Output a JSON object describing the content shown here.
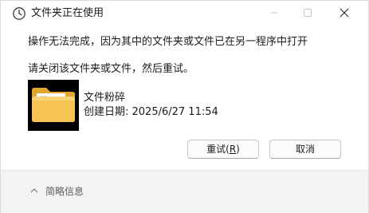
{
  "window": {
    "title": "文件夹正在使用",
    "icon": "clock-icon",
    "controls": [
      "minimize",
      "maximize",
      "close"
    ]
  },
  "message": "操作无法完成，因为其中的文件夹或文件已在另一程序中打开",
  "instruction": "请关闭该文件夹或文件，然后重试。",
  "file": {
    "icon": "folder-icon",
    "name": "文件粉碎",
    "created": "创建日期: 2025/6/27 11:54"
  },
  "buttons": {
    "retry_label": "重试(",
    "retry_hotkey": "R",
    "retry_suffix": ")",
    "cancel_label": "取消"
  },
  "footer": {
    "details_label": "简略信息",
    "details_icon": "chevron-up-icon"
  }
}
